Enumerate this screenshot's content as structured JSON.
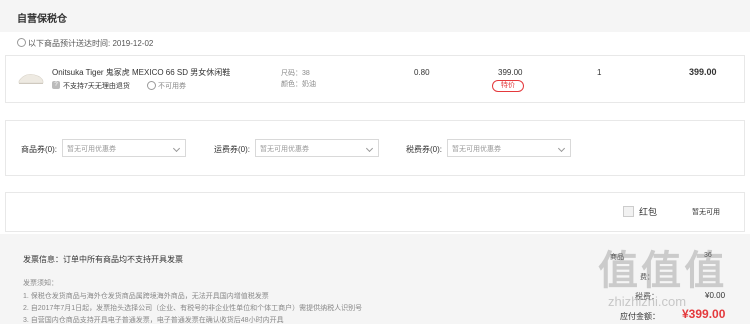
{
  "section": {
    "title": "自营保税仓"
  },
  "delivery": {
    "label": "以下商品预计送达时间: 2019-12-02"
  },
  "product": {
    "name": "Onitsuka Tiger 鬼冢虎 MEXICO 66 SD 男女休闲鞋",
    "return_policy": "不支持7天无理由退货",
    "coupon_policy": "不可用券",
    "size": "尺码：38",
    "color": "颜色：奶油",
    "tax": "0.80",
    "price": "399.00",
    "price_tag": "特价",
    "quantity": "1",
    "subtotal": "399.00"
  },
  "coupons": {
    "goods_label": "商品券(0):",
    "shipping_label": "运费券(0):",
    "tax_label": "税费券(0):",
    "none_text": "暂无可用优惠券"
  },
  "redpacket": {
    "label": "红包",
    "status": "暂无可用"
  },
  "invoice": {
    "info": "发票信息：订单中所有商品均不支持开具发票",
    "notice_title": "发票须知：",
    "notes": [
      "1. 保税仓发货商品与海外仓发货商品属跨境海外商品，无法开具国内增值税发票",
      "2. 自2017年7月1日起，发票抬头选择公司（企业、有税号的非企业性单位和个体工商户）需提供纳税人识别号",
      "3. 自营国内仓商品支持开具电子普通发票，电子普通发票在确认收货后48小时内开具"
    ]
  },
  "summary": {
    "goods_count_label": "商品",
    "goods_count_value": "36",
    "freight_label": "费：",
    "tax_label": "税费：",
    "tax_value": "¥0.00",
    "payable_label": "应付金额：",
    "payable_value": "¥399.00"
  },
  "watermark": {
    "brand": "值 值 值",
    "site": "zhizhizhi.com"
  },
  "colors": {
    "accent": "#e4393c",
    "panel_bg": "#f5f5f5"
  },
  "icons": {
    "clock": "clock-icon",
    "question": "question-icon",
    "no-coupon": "no-coupon-icon"
  }
}
